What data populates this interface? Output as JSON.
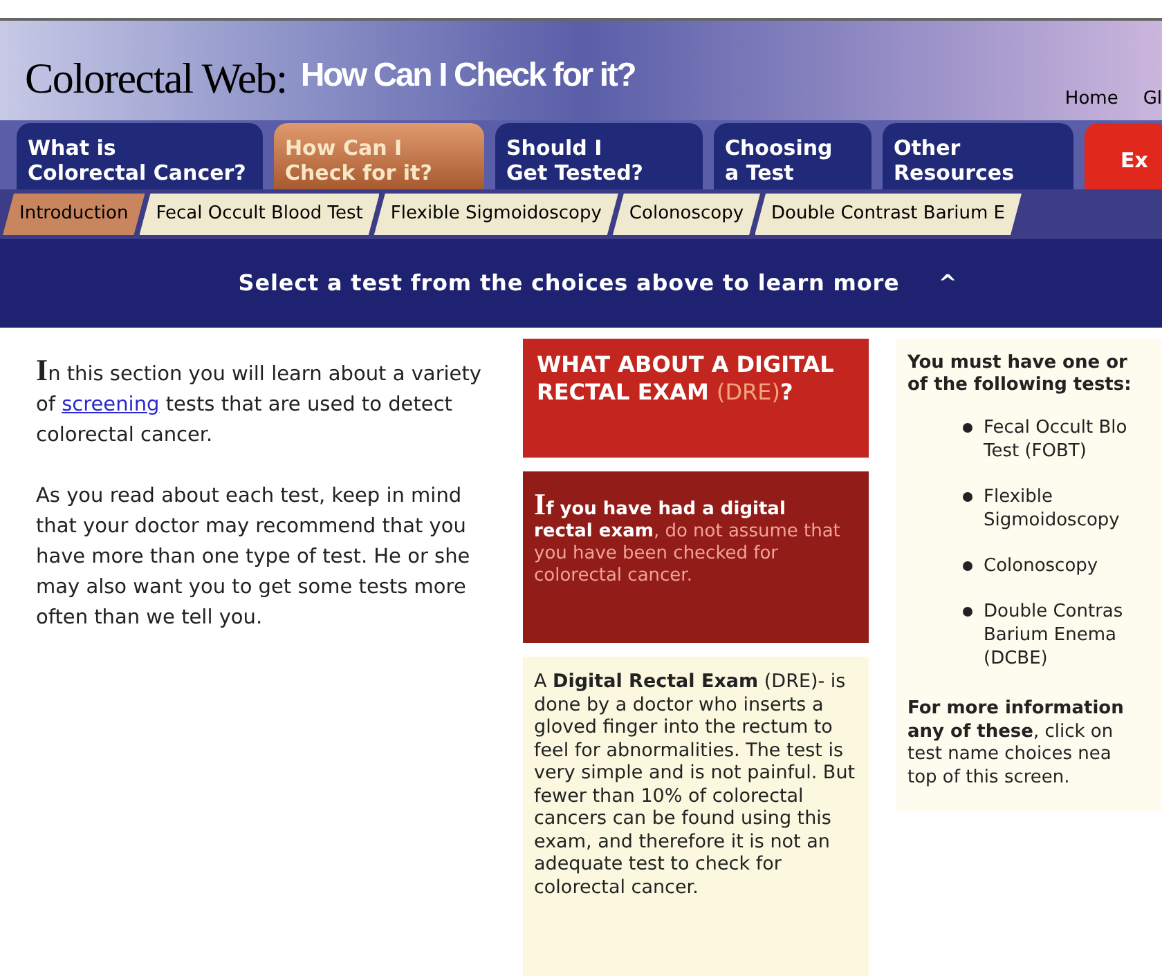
{
  "header": {
    "site_title": "Colorectal Web:",
    "page_title": "How Can I Check for it?",
    "links": [
      "Home",
      "Gl"
    ]
  },
  "tabs": [
    {
      "label": "What is\nColorectal Cancer?",
      "selected": false,
      "kind": "normal"
    },
    {
      "label": "How Can I\nCheck for it?",
      "selected": true,
      "kind": "normal"
    },
    {
      "label": "Should I\nGet Tested?",
      "selected": false,
      "kind": "normal"
    },
    {
      "label": "Choosing\na Test",
      "selected": false,
      "kind": "normal"
    },
    {
      "label": "Other\nResources",
      "selected": false,
      "kind": "normal"
    },
    {
      "label": "Ex",
      "selected": false,
      "kind": "exit"
    }
  ],
  "subtabs": [
    {
      "label": "Introduction",
      "selected": true
    },
    {
      "label": "Fecal Occult Blood Test",
      "selected": false
    },
    {
      "label": "Flexible Sigmoidoscopy",
      "selected": false
    },
    {
      "label": "Colonoscopy",
      "selected": false
    },
    {
      "label": "Double Contrast Barium E",
      "selected": false
    }
  ],
  "banner": {
    "text": "Select a test from the choices above to learn more",
    "icon": "^"
  },
  "intro": {
    "before_link": "In this section you will learn about a variety of",
    "link": "screening",
    "after_link": "tests that are used to detect colorectal cancer.",
    "paragraph_2": "As you read about each test, keep in mind that your doctor may recommend that you have more than one type of test. He or she may also want you to get some tests more often than we tell you."
  },
  "dre_heading": [
    {
      "text": "WHAT ABOUT A DIGITAL RECTAL EXAM ",
      "kind": "plain"
    },
    {
      "text": "(DRE)",
      "kind": "accent"
    },
    {
      "text": "?",
      "kind": "plain"
    }
  ],
  "dre_warning": "**If you have had a digital rectal exam**, do not assume that you have been checked for colorectal cancer.",
  "dre_description": "A **Digital Rectal Exam** (DRE)- is done by a doctor who inserts a gloved finger into the rectum to feel for abnormalities. The test is very simple and is not painful. But fewer than 10% of colorectal cancers can be found using this exam, and therefore it is not an adequate test to check for colorectal cancer.",
  "tests": {
    "heading": "You must have one or\nof the following tests:",
    "items": [
      "Fecal Occult Blo\nTest (FOBT)",
      "Flexible\nSigmoidoscopy",
      "Colonoscopy",
      "Double Contras\nBarium Enema\n(DCBE)"
    ],
    "note": "**For more information\nany of these**, click on\ntest name choices nea\ntop of this screen."
  }
}
